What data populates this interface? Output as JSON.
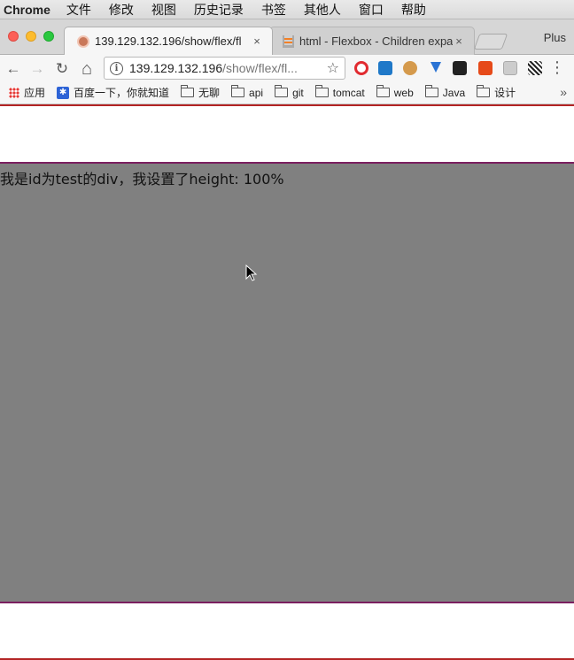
{
  "menubar": {
    "app": "Chrome",
    "items": [
      "文件",
      "修改",
      "视图",
      "历史记录",
      "书签",
      "其他人",
      "窗口",
      "帮助"
    ]
  },
  "tabs": [
    {
      "title": "139.129.132.196/show/flex/fl",
      "close": "×",
      "active": true
    },
    {
      "title": "html - Flexbox - Children expa",
      "close": "×",
      "active": false
    }
  ],
  "profile_label": "Plus",
  "toolbar": {
    "url_host": "139.129.132.196",
    "url_path": "/show/flex/fl...",
    "star": "☆",
    "back": "←",
    "forward": "→",
    "reload": "↻",
    "home": "⌂",
    "menu": "⋮"
  },
  "bookmarks": [
    {
      "label": "应用",
      "icon": "apps-icon"
    },
    {
      "label": "百度一下，你就知道",
      "icon": "baidu-paw-icon"
    },
    {
      "label": "无聊",
      "icon": "folder-icon"
    },
    {
      "label": "api",
      "icon": "folder-icon"
    },
    {
      "label": "git",
      "icon": "folder-icon"
    },
    {
      "label": "tomcat",
      "icon": "folder-icon"
    },
    {
      "label": "web",
      "icon": "folder-icon"
    },
    {
      "label": "Java",
      "icon": "folder-icon"
    },
    {
      "label": "设计",
      "icon": "folder-icon"
    }
  ],
  "bookmarks_more": "»",
  "content": {
    "test_div_text": "我是id为test的div，我设置了height: 100%"
  }
}
